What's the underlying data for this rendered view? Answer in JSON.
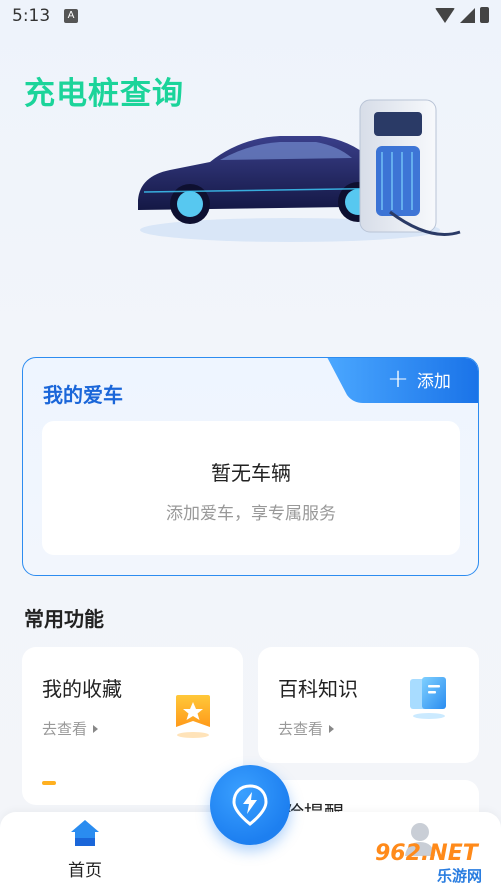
{
  "status_bar": {
    "time": "5:13",
    "notification_glyph": "A"
  },
  "hero": {
    "title": "充电桩查询"
  },
  "my_car": {
    "title": "我的爱车",
    "add_label": "添加",
    "empty_title": "暂无车辆",
    "empty_subtitle": "添加爱车，享专属服务"
  },
  "common_functions": {
    "title": "常用功能",
    "cards": [
      {
        "title": "我的收藏",
        "link": "去查看",
        "icon": "favorite-star-icon"
      },
      {
        "title": "百科知识",
        "link": "去查看",
        "icon": "book-icon"
      }
    ],
    "partial_card_text": "险提醒"
  },
  "bottom_nav": {
    "home_label": "首页",
    "center_icon": "charging-location-icon",
    "mine_icon": "user-icon"
  },
  "watermark": {
    "brand": "962.NET",
    "sub": "乐游网"
  },
  "colors": {
    "accent": "#1d7ff0",
    "hero_green": "#1bd49a",
    "card_title_blue": "#1a66d9"
  }
}
